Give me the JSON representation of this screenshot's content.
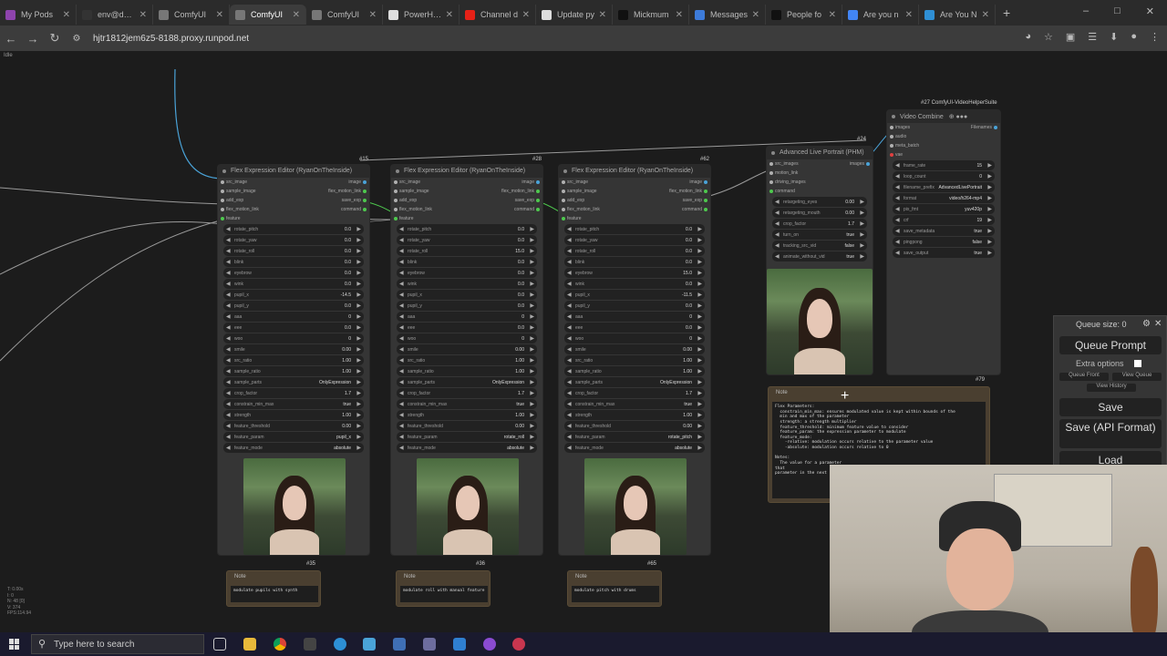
{
  "browser": {
    "tabs": [
      {
        "label": "My Pods",
        "favicon": "runpod-icon",
        "color": "#8e44ad"
      },
      {
        "label": "env@dca5",
        "favicon": "terminal-icon",
        "color": "#333333"
      },
      {
        "label": "ComfyUI",
        "favicon": "globe-icon",
        "color": "#777777"
      },
      {
        "label": "ComfyUI",
        "favicon": "globe-icon",
        "color": "#777777",
        "active": true
      },
      {
        "label": "ComfyUI",
        "favicon": "globe-icon",
        "color": "#777777"
      },
      {
        "label": "PowerHou",
        "favicon": "github-icon",
        "color": "#dddddd"
      },
      {
        "label": "Channel d",
        "favicon": "youtube-icon",
        "color": "#e62117"
      },
      {
        "label": "Update py",
        "favicon": "github-icon",
        "color": "#dddddd"
      },
      {
        "label": "Mickmum",
        "favicon": "x-icon",
        "color": "#111111"
      },
      {
        "label": "Messages",
        "favicon": "messages-icon",
        "color": "#3d7bd9"
      },
      {
        "label": "People fo",
        "favicon": "x-icon",
        "color": "#111111"
      },
      {
        "label": "Are you n",
        "favicon": "google-icon",
        "color": "#4285f4"
      },
      {
        "label": "Are You N",
        "favicon": "gif-icon",
        "color": "#2f8fd4"
      }
    ],
    "url": "hjtr1812jem6z5-8188.proxy.runpod.net",
    "new_tab": "+",
    "tab_close": "✕"
  },
  "status": {
    "idle": "Idle"
  },
  "nodes": {
    "flex_labels": {
      "inputs": [
        "src_image",
        "sample_image",
        "add_exp",
        "flex_motion_link",
        "feature"
      ],
      "outputs": [
        "image",
        "flex_motion_link",
        "save_exp",
        "command"
      ],
      "widgets": [
        "rotate_pitch",
        "rotate_yaw",
        "rotate_roll",
        "blink",
        "eyebrow",
        "wink",
        "pupil_x",
        "pupil_y",
        "aaa",
        "eee",
        "woo",
        "smile",
        "src_ratio",
        "sample_ratio",
        "sample_parts",
        "crop_factor",
        "constrain_min_max",
        "strength",
        "feature_threshold",
        "feature_param",
        "feature_mode"
      ]
    },
    "flex": [
      {
        "title": "Flex Expression Editor (RyanOnTheInside)",
        "id": "#15",
        "values": [
          "0.0",
          "0.0",
          "0.0",
          "0.0",
          "0.0",
          "0.0",
          "-14.5",
          "0.0",
          "0",
          "0.0",
          "0",
          "0.00",
          "1.00",
          "1.00",
          "OnlyExpression",
          "1.7",
          "true",
          "1.00",
          "0.00",
          "pupil_x",
          "absolute"
        ]
      },
      {
        "title": "Flex Expression Editor (RyanOnTheInside)",
        "id": "#28",
        "values": [
          "0.0",
          "0.0",
          "15.0",
          "0.0",
          "0.0",
          "0.0",
          "0.0",
          "0.0",
          "0",
          "0.0",
          "0",
          "0.00",
          "1.00",
          "1.00",
          "OnlyExpression",
          "1.7",
          "true",
          "1.00",
          "0.00",
          "rotate_roll",
          "absolute"
        ]
      },
      {
        "title": "Flex Expression Editor (RyanOnTheInside)",
        "id": "#62",
        "values": [
          "0.0",
          "0.0",
          "0.0",
          "0.0",
          "15.0",
          "0.0",
          "-11.5",
          "0.0",
          "0",
          "0.0",
          "0",
          "0.00",
          "1.00",
          "1.00",
          "OnlyExpression",
          "1.7",
          "true",
          "1.00",
          "0.00",
          "rotate_pitch",
          "absolute"
        ]
      }
    ],
    "live_portrait": {
      "title": "Advanced Live Portrait (PHM)",
      "id": "#24",
      "inputs": [
        "src_images",
        "motion_link",
        "driving_images"
      ],
      "outputs": [
        "images"
      ],
      "extra_io": [
        "command"
      ],
      "widgets": [
        {
          "label": "retargeting_eyes",
          "value": "0.00"
        },
        {
          "label": "retargeting_mouth",
          "value": "0.00"
        },
        {
          "label": "crop_factor",
          "value": "1.7"
        },
        {
          "label": "turn_on",
          "value": "true"
        },
        {
          "label": "tracking_src_vid",
          "value": "false"
        },
        {
          "label": "animate_without_vid",
          "value": "true"
        }
      ]
    },
    "video_combine": {
      "header": "#27 ComfyUI-VideoHelperSuite",
      "title": "Video Combine",
      "title_glyphs": "⊕ ●●●",
      "inputs": [
        "images",
        "audio",
        "meta_batch",
        "vae"
      ],
      "outputs": [
        "Filenames"
      ],
      "widgets": [
        {
          "label": "frame_rate",
          "value": "15"
        },
        {
          "label": "loop_count",
          "value": "0"
        },
        {
          "label": "filename_prefix",
          "value": "AdvancedLivePortrait"
        },
        {
          "label": "format",
          "value": "video/h264-mp4"
        },
        {
          "label": "pix_fmt",
          "value": "yuv420p"
        },
        {
          "label": "crf",
          "value": "19"
        },
        {
          "label": "save_metadata",
          "value": "true"
        },
        {
          "label": "pingpong",
          "value": "false"
        },
        {
          "label": "save_output",
          "value": "true"
        }
      ]
    },
    "note_main": {
      "title": "Note",
      "id": "#79",
      "text": "Flex Parameters:\n  constrain_min_max: ensures modulated value is kept within bounds of the\n  min and max of the parameter\n  strength: a strength multiplier\n  feature_threshold: minimum feature value to consider\n  feature_param: the expression parameter to modulate\n  feature_mode:\n    -relative: modulation occurs relative to the parameter value\n    -absolute: modulation occurs relative to 0\n\nNotes:\n  The value for a parameter\nthat\nparameter in the next"
    },
    "notes_small": [
      {
        "title": "Note",
        "id": "#35",
        "text": "modulate pupils with synth"
      },
      {
        "title": "Note",
        "id": "#36",
        "text": "modulate roll with manual feature"
      },
      {
        "title": "Note",
        "id": "#65",
        "text": "modulate pitch with drums"
      }
    ]
  },
  "queue": {
    "size_label": "Queue size: 0",
    "queue_prompt": "Queue Prompt",
    "extra_options": "Extra options",
    "queue_front": "Queue Front",
    "view_queue": "View Queue",
    "view_history": "View History",
    "save": "Save",
    "save_api": "Save (API Format)",
    "load": "Load",
    "gear": "⚙",
    "close": "✕"
  },
  "stats": [
    "T: 0.00s",
    "I: 0",
    "N: 48 [0]",
    "V: 374",
    "FPS:114.94"
  ],
  "taskbar": {
    "search_placeholder": "Type here to search"
  }
}
